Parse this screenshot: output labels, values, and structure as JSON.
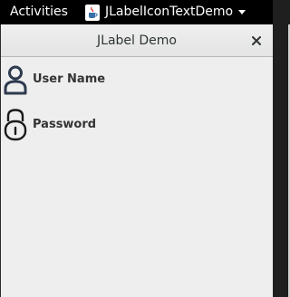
{
  "topbar": {
    "activities_label": "Activities",
    "app_name": "JLabelIconTextDemo",
    "app_icon": "java-cup-icon",
    "menu_caret_icon": "caret-down-icon"
  },
  "window": {
    "title": "JLabel Demo",
    "close_icon": "close-icon"
  },
  "labels": [
    {
      "text": "User Name",
      "icon": "user-icon"
    },
    {
      "text": "Password",
      "icon": "lock-icon"
    }
  ],
  "colors": {
    "topbar_bg": "#000000",
    "window_bg": "#eeeeee",
    "icon_color": "#2e3a4e"
  }
}
